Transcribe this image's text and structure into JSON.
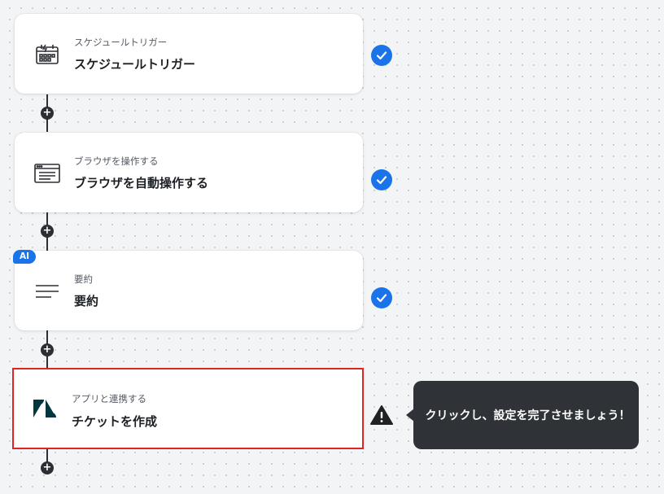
{
  "steps": [
    {
      "subtitle": "スケジュールトリガー",
      "title": "スケジュールトリガー",
      "icon": "calendar-icon",
      "status": "complete"
    },
    {
      "subtitle": "ブラウザを操作する",
      "title": "ブラウザを自動操作する",
      "icon": "browser-window-icon",
      "status": "complete"
    },
    {
      "subtitle": "要約",
      "title": "要約",
      "icon": "text-lines-icon",
      "status": "complete",
      "badge": "AI"
    },
    {
      "subtitle": "アプリと連携する",
      "title": "チケットを作成",
      "icon": "zendesk-icon",
      "status": "warning"
    }
  ],
  "add_step_symbol": "+",
  "tooltip": {
    "text": "クリックし、設定を完了させましょう！"
  },
  "colors": {
    "accent": "#1a73e8",
    "selected_border": "#e02424",
    "zendesk": "#03363d",
    "tooltip_bg": "#2f3236"
  }
}
